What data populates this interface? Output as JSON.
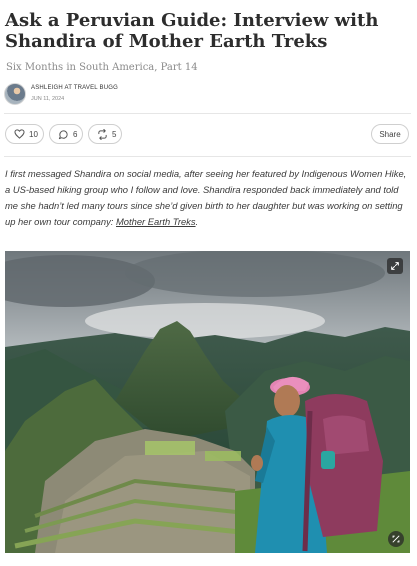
{
  "post": {
    "title": "Ask a Peruvian Guide: Interview with Shandira of Mother Earth Treks",
    "subtitle": "Six Months in South America, Part 14",
    "author": "ASHLEIGH AT TRAVEL BUGG",
    "date": "JUN 11, 2024"
  },
  "actions": {
    "likes": "10",
    "comments": "6",
    "restacks": "5",
    "share_label": "Share"
  },
  "body": {
    "text_before_link": "I first messaged Shandira on social media, after seeing her featured by Indigenous Women Hike, a US-based hiking group who I follow and love. Shandira responded back immediately and told me she hadn’t led many tours since she’d given birth to her daughter but was working on setting up her own tour company: ",
    "link_text": "Mother Earth Treks",
    "text_after_link": "."
  },
  "icons": {
    "like": "heart-icon",
    "comment": "comment-bubble-icon",
    "restack": "restack-arrows-icon",
    "expand": "expand-icon",
    "photo_tool": "image-tool-icon"
  },
  "colors": {
    "text": "#2d2d2d",
    "muted": "#8a8a8a",
    "pill_border": "#cfcfcf",
    "backpack": "#8e3b5e",
    "jacket": "#1f8fb0",
    "cap": "#e07aa8"
  }
}
